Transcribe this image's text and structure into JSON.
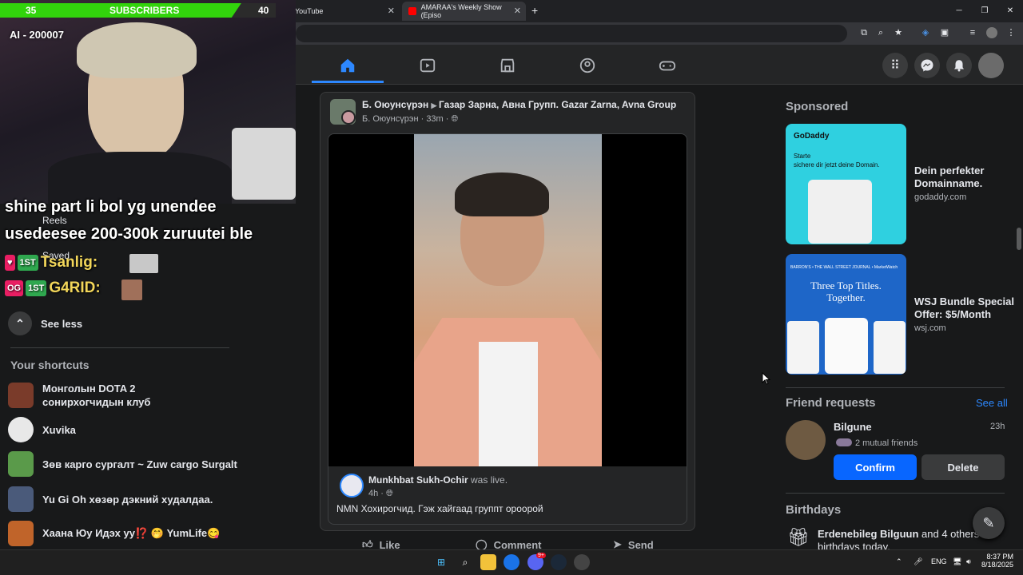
{
  "browser": {
    "tabs": [
      {
        "label": "YouTube",
        "icon": "youtube-icon"
      },
      {
        "label": "AMARAA's Weekly Show (Episo",
        "icon": "youtube-icon"
      }
    ],
    "new_tab_label": "+"
  },
  "stream_overlay": {
    "sub_goal_current": "35",
    "sub_goal_label": "SUBSCRIBERS",
    "sub_goal_target": "40",
    "sub_goal_progress": 0.875,
    "ai_label": "AI - 200007",
    "message_line1": "shine part li bol yg unendee",
    "message_line2": "usedeesee 200-300k zuruutei ble",
    "chat": [
      {
        "badge1": "1ST",
        "name": "Tsanlig:"
      },
      {
        "badge0": "OG",
        "badge1": "1ST",
        "name": "G4RID:"
      }
    ]
  },
  "sidebar": {
    "hidden_items": [
      "Reels",
      "Saved"
    ],
    "see_less": "See less",
    "shortcuts_title": "Your shortcuts",
    "shortcuts": [
      {
        "label": "Монголын DOTA 2 сонирхогчидын клуб",
        "color": "#7a3b2a"
      },
      {
        "label": "Xuvika",
        "color": "#e8e8e8"
      },
      {
        "label": "Зөв карго сургалт ~ Zuw cargo Surgalt",
        "color": "#5a9a4a"
      },
      {
        "label": "Yu Gi Oh хөзөр дэкний худалдаа.",
        "color": "#4a5a7a"
      },
      {
        "label": "Хаана Юу Идэх уу⁉️ 🤭 YumLife😋",
        "color": "#c0642a"
      }
    ]
  },
  "post": {
    "author": "Б. Оюунсүрэн",
    "group": "Газар Зарна, Авна Групп. Gazar Zarna, Avna Group",
    "subauthor": "Б. Оюунсүрэн",
    "time": "33m",
    "shared_author": "Munkhbat Sukh-Ochir",
    "shared_action": "was live.",
    "shared_time": "4h",
    "shared_text": "NMN Хохирогчид.  Гэж хайгаад группт ороорой",
    "actions": {
      "like": "Like",
      "comment": "Comment",
      "send": "Send"
    }
  },
  "right": {
    "sponsored_title": "Sponsored",
    "ads": [
      {
        "title": "Dein perfekter Domainname.",
        "domain": "godaddy.com",
        "img_brand": "GoDaddy",
        "img_text1": "Starte",
        "img_text2": "sichere dir jetzt deine Domain."
      },
      {
        "title": "WSJ Bundle Special Offer: $5/Month",
        "domain": "wsj.com",
        "img_brand": "BARRON'S • THE WALL STREET JOURNAL • MarketWatch",
        "img_text1": "Three Top Titles.",
        "img_text2": "Together."
      }
    ],
    "friend_requests_title": "Friend requests",
    "see_all": "See all",
    "request": {
      "name": "Bilgune",
      "time": "23h",
      "mutual": "2 mutual friends",
      "confirm": "Confirm",
      "delete": "Delete"
    },
    "birthdays_title": "Birthdays",
    "birthday_name": "Erdenebileg Bilguun",
    "birthday_rest": " and 4 others h",
    "birthday_line2": "birthdays today."
  },
  "taskbar": {
    "lang": "ENG",
    "time": "8:37 PM",
    "date": "8/18/2025",
    "discord_badge": "9+"
  },
  "colors": {
    "accent": "#2d88ff",
    "confirm": "#0866ff",
    "sub_green": "#32d30c"
  }
}
